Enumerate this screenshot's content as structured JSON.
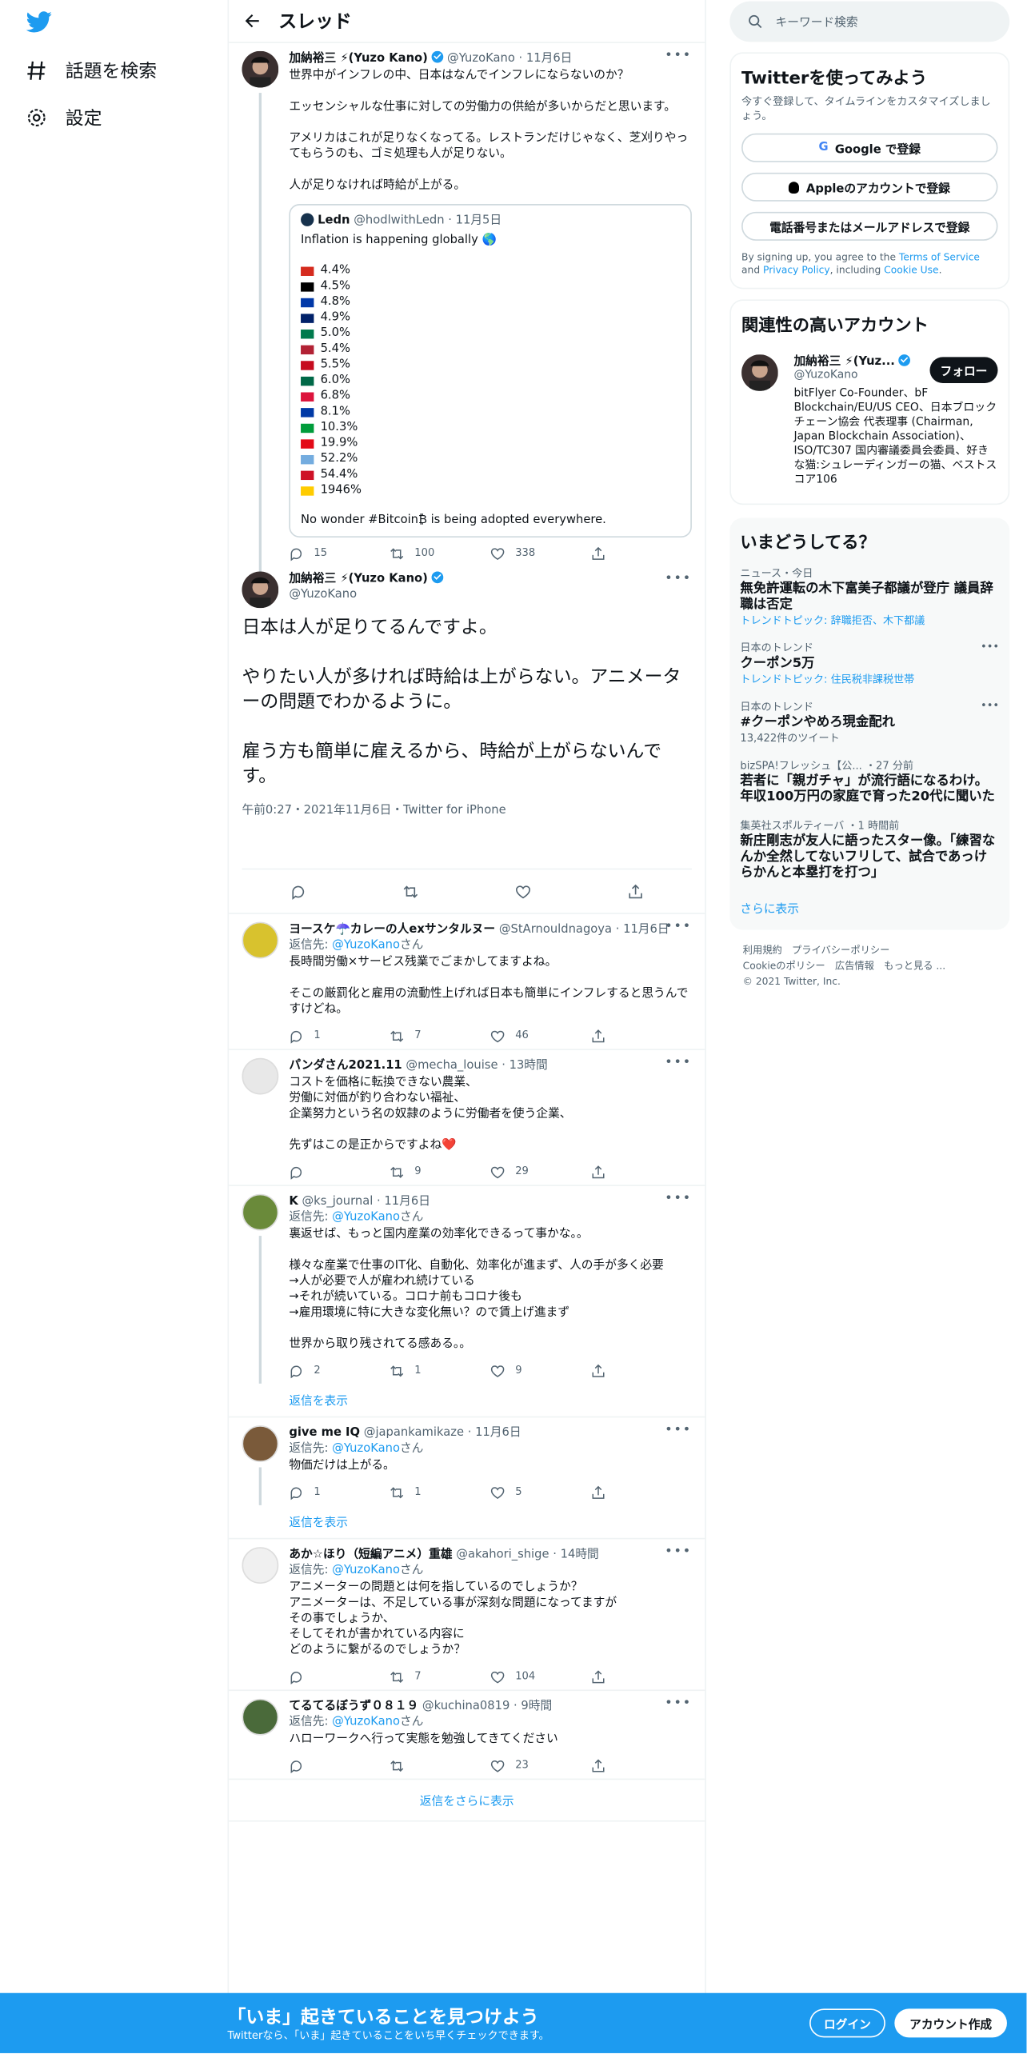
{
  "nav": {
    "explore": "話題を検索",
    "settings": "設定"
  },
  "header": {
    "title": "スレッド"
  },
  "main": {
    "name": "加納裕三 ⚡(Yuzo Kano)",
    "handle": "@YuzoKano",
    "date": "11月6日",
    "text": "世界中がインフレの中、日本はなんでインフレにならないのか？\n\nエッセンシャルな仕事に対しての労働力の供給が多いからだと思います。\n\nアメリカはこれが足りなくなってる。レストランだけじゃなく、芝刈りやってもらうのも、ゴミ処理も人が足りない。\n\n人が足りなければ時給が上がる。",
    "quote": {
      "name": "Ledn",
      "handle": "@hodlwithLedn",
      "date": "11月5日",
      "intro": "Inflation is happening globally 🌎",
      "rates": [
        {
          "v": "4.4%",
          "c": "#d52b1e"
        },
        {
          "v": "4.5%",
          "c": "#000000"
        },
        {
          "v": "4.8%",
          "c": "#0038a8"
        },
        {
          "v": "4.9%",
          "c": "#012169"
        },
        {
          "v": "5.0%",
          "c": "#007a4d"
        },
        {
          "v": "5.4%",
          "c": "#b22234"
        },
        {
          "v": "5.5%",
          "c": "#c60b1e"
        },
        {
          "v": "6.0%",
          "c": "#006847"
        },
        {
          "v": "6.8%",
          "c": "#dc143c"
        },
        {
          "v": "8.1%",
          "c": "#0039a6"
        },
        {
          "v": "10.3%",
          "c": "#009c3b"
        },
        {
          "v": "19.9%",
          "c": "#e30a17"
        },
        {
          "v": "52.2%",
          "c": "#74acdf"
        },
        {
          "v": "54.4%",
          "c": "#ce1126"
        },
        {
          "v": "1946%",
          "c": "#ffcc00"
        }
      ],
      "outro": "No wonder #Bitcoin₿  is being adopted everywhere."
    },
    "replies": "15",
    "retweets": "100",
    "likes": "338"
  },
  "focus": {
    "name": "加納裕三 ⚡(Yuzo Kano)",
    "handle": "@YuzoKano",
    "text": "日本は人が足りてるんですよ。\n\nやりたい人が多ければ時給は上がらない。アニメーターの問題でわかるように。\n\n雇う方も簡単に雇えるから、時給が上がらないんです。",
    "meta": "午前0:27・2021年11月6日・Twitter for iPhone"
  },
  "replies": [
    {
      "name": "ヨースケ☂️カレーの人exサンタルヌー",
      "handle": "@StArnouldnagoya",
      "date": "11月6日",
      "to": "@YuzoKano",
      "text": "長時間労働×サービス残業でごまかしてますよね。\n\nそこの厳罰化と雇用の流動性上げれば日本も簡単にインフレすると思うんですけどね。",
      "r": "1",
      "rt": "7",
      "l": "46"
    },
    {
      "name": "パンダさん2021.11",
      "handle": "@mecha_louise",
      "date": "13時間",
      "to": "",
      "text": "コストを価格に転換できない農業、\n労働に対価が釣り合わない福祉、\n企業努力という名の奴隷のように労働者を使う企業、\n\n先ずはこの是正からですよね❤️",
      "r": "",
      "rt": "9",
      "l": "29"
    },
    {
      "name": "K",
      "handle": "@ks_journal",
      "date": "11月6日",
      "to": "@YuzoKano",
      "text": "裏返せば、もっと国内産業の効率化できるって事かな。。\n\n様々な産業で仕事のIT化、自動化、効率化が進まず、人の手が多く必要\n→人が必要で人が雇われ続けている\n→それが続いている。コロナ前もコロナ後も\n→雇用環境に特に大きな変化無い？ので賃上げ進まず\n\n世界から取り残されてる感ある。。",
      "r": "2",
      "rt": "1",
      "l": "9",
      "show": "返信を表示"
    },
    {
      "name": "give me IQ",
      "handle": "@japankamikaze",
      "date": "11月6日",
      "to": "@YuzoKano",
      "text": "物価だけは上がる。",
      "r": "1",
      "rt": "1",
      "l": "5",
      "show": "返信を表示"
    },
    {
      "name": "あか☆ほり（短編アニメ）重雄",
      "handle": "@akahori_shige",
      "date": "14時間",
      "to": "@YuzoKano",
      "text": "アニメーターの問題とは何を指しているのでしょうか？\nアニメーターは、不足している事が深刻な問題になってますが\nその事でしょうか、\nそしてそれが書かれている内容に\nどのように繋がるのでしょうか？",
      "r": "",
      "rt": "7",
      "l": "104"
    },
    {
      "name": "てるてるぼうず０８１９",
      "handle": "@kuchina0819",
      "date": "9時間",
      "to": "@YuzoKano",
      "text": "ハローワークへ行って実態を勉強してきてください",
      "r": "",
      "rt": "",
      "l": "23"
    }
  ],
  "more_replies": "返信をさらに表示",
  "reply_prefix": "返信先: ",
  "reply_suffix": "さん",
  "search": {
    "placeholder": "キーワード検索"
  },
  "signup": {
    "title": "Twitterを使ってみよう",
    "desc": "今すぐ登録して、タイムラインをカスタマイズしましょう。",
    "google": "Google で登録",
    "apple": "Appleのアカウントで登録",
    "phone": "電話番号またはメールアドレスで登録",
    "legal_a": "By signing up, you agree to the ",
    "terms": "Terms of Service",
    "legal_b": " and ",
    "privacy": "Privacy Policy",
    "legal_c": ", including ",
    "cookie": "Cookie Use",
    "legal_d": "."
  },
  "related": {
    "title": "関連性の高いアカウント",
    "name": "加納裕三 ⚡(Yuz...",
    "handle": "@YuzoKano",
    "follow": "フォロー",
    "bio": "bitFlyer Co-Founder、bF Blockchain/EU/US CEO、日本ブロックチェーン協会 代表理事 (Chairman, Japan Blockchain Association)、ISO/TC307 国内審議委員会委員、好きな猫:シュレーディンガーの猫、ベストスコア106"
  },
  "trends": {
    "title": "いまどうしてる？",
    "items": [
      {
        "c": "ニュース・今日",
        "h": "無免許運転の木下富美子都議が登庁 議員辞職は否定",
        "l": "トレンドトピック: 辞職拒否、木下都議"
      },
      {
        "c": "日本のトレンド",
        "h": "クーポン5万",
        "l": "トレンドトピック: 住民税非課税世帯"
      },
      {
        "c": "日本のトレンド",
        "h": "#クーポンやめろ現金配れ",
        "l": "13,422件のツイート"
      },
      {
        "c": "bizSPA!フレッシュ【公... ・27 分前",
        "h": "若者に「親ガチャ」が流行語になるわけ。年収100万円の家庭で育った20代に聞いた",
        "l": ""
      },
      {
        "c": "集英社スポルティーバ ・1 時間前",
        "h": "新庄剛志が友人に語ったスター像。「練習なんか全然してないフリして、試合であっけらかんと本塁打を打つ」",
        "l": ""
      }
    ],
    "more": "さらに表示"
  },
  "footer": {
    "l1": "利用規約　プライバシーポリシー",
    "l2": "Cookieのポリシー　広告情報　もっと見る ...",
    "l3": "© 2021 Twitter, Inc."
  },
  "banner": {
    "title": "「いま」起きていることを見つけよう",
    "sub": "Twitterなら、「いま」起きていることをいち早くチェックできます。",
    "login": "ログイン",
    "signup": "アカウント作成"
  }
}
